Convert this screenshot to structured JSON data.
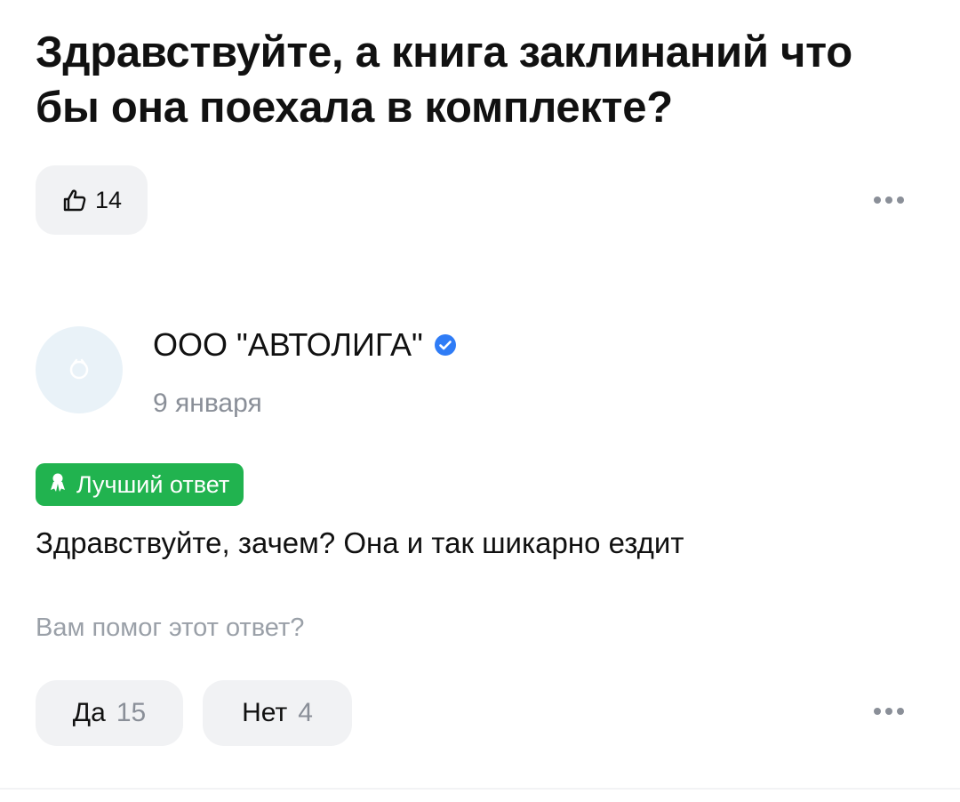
{
  "question": {
    "title": "Здравствуйте, а книга заклинаний что бы она поехала в комплекте?",
    "likes": "14"
  },
  "answer": {
    "author": "ООО \"АВТОЛИГА\"",
    "verified": true,
    "date": "9 января",
    "badge": "Лучший ответ",
    "text": "Здравствуйте, зачем? Она и так шикарно ездит"
  },
  "feedback": {
    "question": "Вам помог этот ответ?",
    "yes_label": "Да",
    "yes_count": "15",
    "no_label": "Нет",
    "no_count": "4"
  },
  "colors": {
    "best_badge": "#21b34f",
    "verified": "#2f7cf6",
    "pill_bg": "#f1f2f4",
    "muted_text": "#8a8f98"
  },
  "icons": {
    "like": "thumbs-up-icon",
    "more": "more-horizontal-icon",
    "verified": "verified-check-icon",
    "best": "award-icon",
    "avatar": "company-avatar-icon"
  }
}
